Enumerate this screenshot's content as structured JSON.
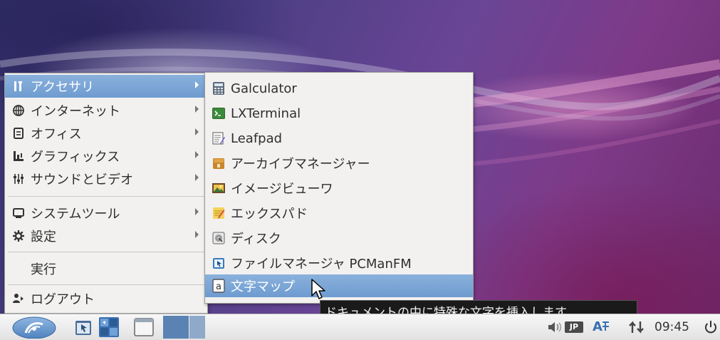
{
  "main_menu": {
    "items": [
      {
        "label": "アクセサリ",
        "icon": "accessories-icon",
        "submenu": true,
        "selected": true
      },
      {
        "label": "インターネット",
        "icon": "globe-icon",
        "submenu": true
      },
      {
        "label": "オフィス",
        "icon": "document-icon",
        "submenu": true
      },
      {
        "label": "グラフィックス",
        "icon": "graphics-icon",
        "submenu": true
      },
      {
        "label": "サウンドとビデオ",
        "icon": "sound-video-icon",
        "submenu": true
      },
      {
        "label": "システムツール",
        "icon": "monitor-icon",
        "submenu": true
      },
      {
        "label": "設定",
        "icon": "gear-icon",
        "submenu": true
      },
      {
        "label": "実行",
        "icon": "",
        "submenu": false
      },
      {
        "label": "ログアウト",
        "icon": "logout-icon",
        "submenu": false
      }
    ]
  },
  "submenu": {
    "items": [
      {
        "label": "Galculator",
        "icon": "calculator-icon"
      },
      {
        "label": "LXTerminal",
        "icon": "terminal-icon"
      },
      {
        "label": "Leafpad",
        "icon": "text-editor-icon"
      },
      {
        "label": "アーカイブマネージャー",
        "icon": "archive-icon"
      },
      {
        "label": "イメージビューワ",
        "icon": "image-viewer-icon"
      },
      {
        "label": "エックスパド",
        "icon": "xpad-icon"
      },
      {
        "label": "ディスク",
        "icon": "disk-icon"
      },
      {
        "label": "ファイルマネージャ PCManFM",
        "icon": "file-manager-icon"
      },
      {
        "label": "文字マップ",
        "icon": "character-map-icon",
        "selected": true
      }
    ]
  },
  "tooltip": {
    "text": "ドキュメントの中に特殊な文字を挿入します"
  },
  "panel": {
    "keyboard_layout": "JP",
    "input_method": "A",
    "clock": "09:45"
  },
  "colors": {
    "selection": "#7aa5d6",
    "panel": "#ececec",
    "tooltip_bg": "#1a1a1a"
  }
}
